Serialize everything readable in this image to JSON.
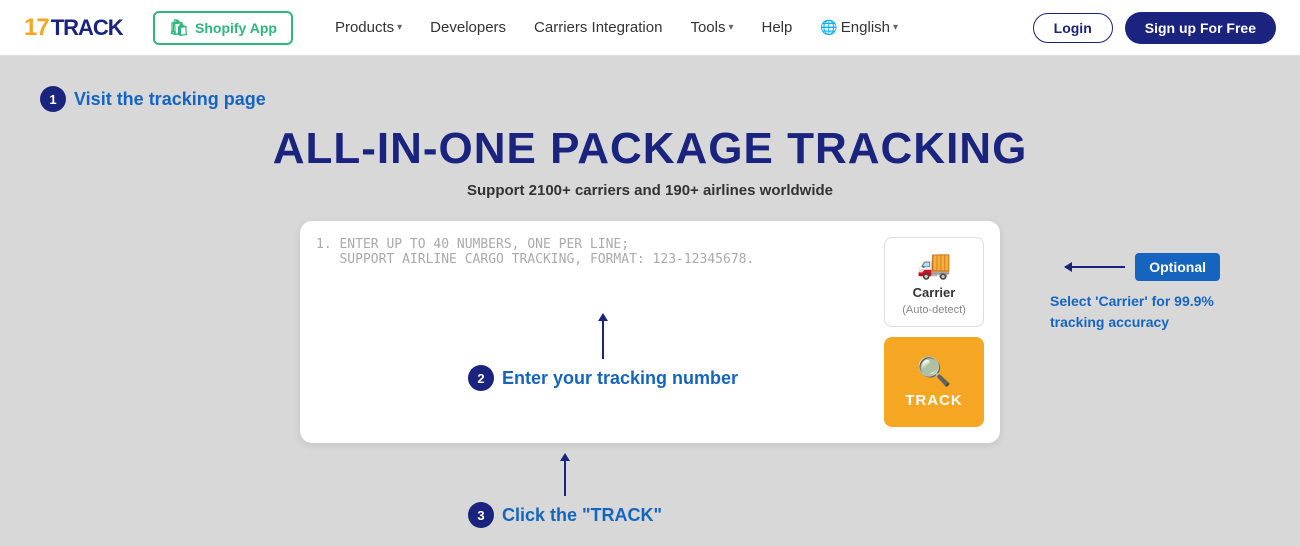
{
  "logo": {
    "number": "17",
    "text": "TRACK"
  },
  "nav": {
    "shopify_label": "Shopify App",
    "products_label": "Products",
    "developers_label": "Developers",
    "carriers_label": "Carriers Integration",
    "tools_label": "Tools",
    "help_label": "Help",
    "language_label": "English",
    "login_label": "Login",
    "signup_label": "Sign up For Free"
  },
  "step1": {
    "number": "1",
    "label": "Visit the tracking page"
  },
  "hero": {
    "title": "ALL-IN-ONE PACKAGE TRACKING",
    "subtitle": "Support 2100+ carriers and 190+ airlines worldwide"
  },
  "tracking_input": {
    "placeholder_line1": "1. ENTER UP TO 40 NUMBERS, ONE PER LINE;",
    "placeholder_line2": "   SUPPORT AIRLINE CARGO TRACKING, FORMAT: 123-12345678."
  },
  "carrier_btn": {
    "label": "Carrier",
    "sublabel": "(Auto-detect)"
  },
  "track_btn": {
    "label": "TRACK"
  },
  "step2": {
    "number": "2",
    "label": "Enter your tracking number"
  },
  "optional_tag": "Optional",
  "right_annotation": "Select 'Carrier' for 99.9% tracking accuracy",
  "step3": {
    "number": "3",
    "label": "Click the \"TRACK\""
  }
}
